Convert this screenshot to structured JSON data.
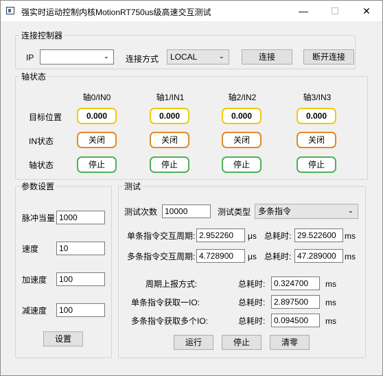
{
  "window": {
    "title": "强实时运动控制内核MotionRT750us级高速交互测试",
    "minimize_icon": "—",
    "maximize_icon": "☐",
    "close_icon": "✕"
  },
  "connection": {
    "legend": "连接控制器",
    "ip_label": "IP",
    "ip_value": "",
    "method_label": "连接方式",
    "method_value": "LOCAL",
    "connect_label": "连接",
    "disconnect_label": "断开连接"
  },
  "axis_status": {
    "legend": "轴状态",
    "row_labels": {
      "target": "目标位置",
      "in": "IN状态",
      "axis": "轴状态"
    },
    "axes": [
      {
        "header": "轴0/IN0",
        "target": "0.000",
        "in_state": "关闭",
        "axis_state": "停止"
      },
      {
        "header": "轴1/IN1",
        "target": "0.000",
        "in_state": "关闭",
        "axis_state": "停止"
      },
      {
        "header": "轴2/IN2",
        "target": "0.000",
        "in_state": "关闭",
        "axis_state": "停止"
      },
      {
        "header": "轴3/IN3",
        "target": "0.000",
        "in_state": "关闭",
        "axis_state": "停止"
      }
    ]
  },
  "params": {
    "legend": "参数设置",
    "pulse_label": "脉冲当量",
    "pulse_value": "1000",
    "speed_label": "速度",
    "speed_value": "10",
    "accel_label": "加速度",
    "accel_value": "100",
    "decel_label": "减速度",
    "decel_value": "100",
    "set_label": "设置"
  },
  "test": {
    "legend": "测试",
    "count_label": "测试次数",
    "count_value": "10000",
    "type_label": "测试类型",
    "type_value": "多条指令",
    "single_cycle_label": "单条指令交互周期:",
    "single_cycle_value": "2.952260",
    "us_unit1": "μs",
    "single_total_label": "总耗时:",
    "single_total_value": "29.522600",
    "ms_unit1": "ms",
    "multi_cycle_label": "多条指令交互周期:",
    "multi_cycle_value": "4.728900",
    "us_unit2": "μs",
    "multi_total_label": "总耗时:",
    "multi_total_value": "47.289000",
    "ms_unit2": "ms",
    "report_label": "周期上报方式:",
    "report_total_label": "总耗时:",
    "report_total_value": "0.324700",
    "ms_unit3": "ms",
    "single_io_label": "单条指令获取一IO:",
    "single_io_total_label": "总耗时:",
    "single_io_total_value": "2.897500",
    "ms_unit4": "ms",
    "multi_io_label": "多条指令获取多个IO:",
    "multi_io_total_label": "总耗时:",
    "multi_io_total_value": "0.094500",
    "ms_unit5": "ms",
    "run_label": "运行",
    "stop_label": "停止",
    "clear_label": "清零"
  }
}
